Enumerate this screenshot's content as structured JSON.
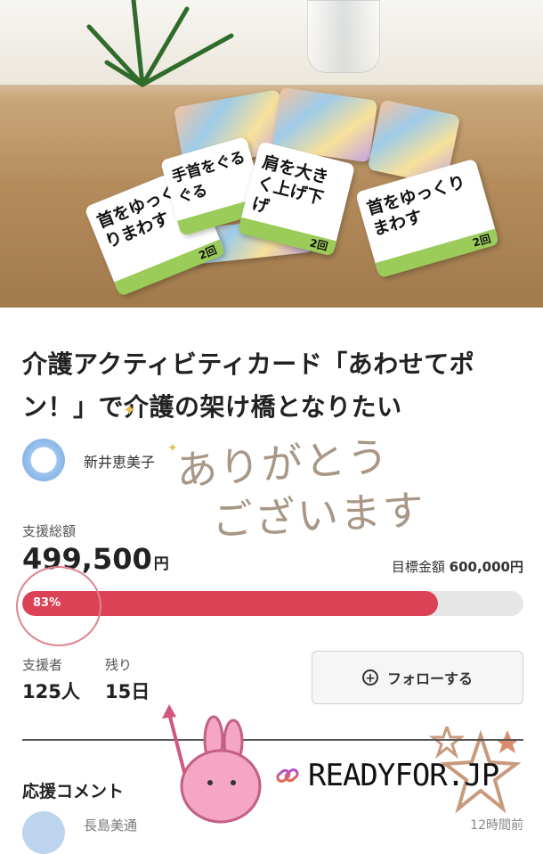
{
  "project": {
    "title": "介護アクティビティカード「あわせてポン！」で介護の架け橋となりたい",
    "owner": "新井恵美子"
  },
  "hero_cards": [
    {
      "text": "首をゆっくりまわす",
      "count": "2回"
    },
    {
      "text": "手首をぐるぐる",
      "count": ""
    },
    {
      "text": "肩を大きく上げ下げ",
      "count": "2回"
    },
    {
      "text": "首をゆっくりまわす",
      "count": "2回"
    }
  ],
  "overlay": {
    "thanks_line1": "ありがとう",
    "thanks_line2": "ございます",
    "brand": "READYFOR.JP"
  },
  "funding": {
    "total_label": "支援総額",
    "amount": "499,500",
    "currency": "円",
    "goal_label": "目標金額",
    "goal_value": "600,000円",
    "percent_text": "83%",
    "progress": 0.83
  },
  "stats": {
    "supporters_label": "支援者",
    "supporters_value": "125人",
    "remaining_label": "残り",
    "remaining_value": "15日"
  },
  "follow_button": "フォローする",
  "comments": {
    "heading": "応援コメント",
    "first_name": "長島美通",
    "first_time": "12時間前"
  },
  "colors": {
    "progress_fill": "#db4256",
    "progress_track": "#e6e6e6",
    "card_green": "#9bcc5a"
  }
}
